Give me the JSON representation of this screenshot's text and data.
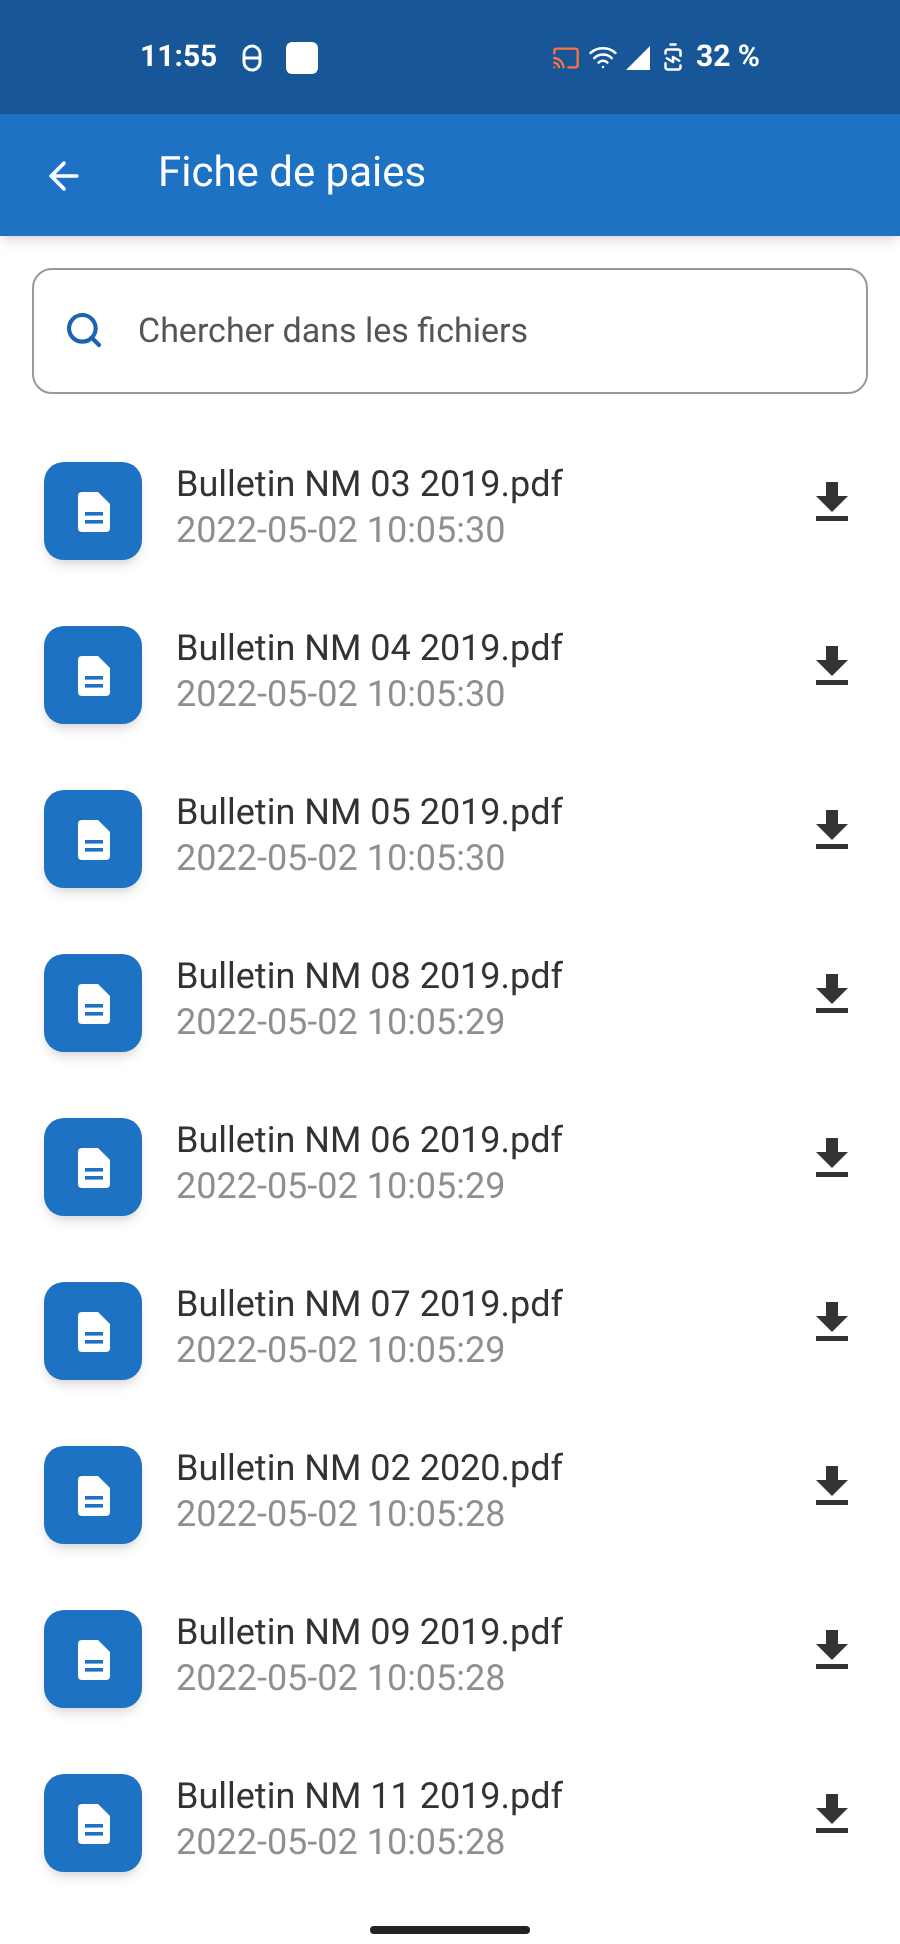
{
  "status_bar": {
    "time": "11:55",
    "battery": "32 %"
  },
  "app_bar": {
    "title": "Fiche de paies"
  },
  "search": {
    "placeholder": "Chercher dans les fichiers"
  },
  "files": [
    {
      "name": "Bulletin NM 03 2019.pdf",
      "date": "2022-05-02 10:05:30"
    },
    {
      "name": "Bulletin NM 04 2019.pdf",
      "date": "2022-05-02 10:05:30"
    },
    {
      "name": "Bulletin NM 05 2019.pdf",
      "date": "2022-05-02 10:05:30"
    },
    {
      "name": "Bulletin NM 08 2019.pdf",
      "date": "2022-05-02 10:05:29"
    },
    {
      "name": "Bulletin NM 06 2019.pdf",
      "date": "2022-05-02 10:05:29"
    },
    {
      "name": "Bulletin NM 07 2019.pdf",
      "date": "2022-05-02 10:05:29"
    },
    {
      "name": "Bulletin NM 02 2020.pdf",
      "date": "2022-05-02 10:05:28"
    },
    {
      "name": "Bulletin NM 09 2019.pdf",
      "date": "2022-05-02 10:05:28"
    },
    {
      "name": "Bulletin NM 11 2019.pdf",
      "date": "2022-05-02 10:05:28"
    }
  ]
}
